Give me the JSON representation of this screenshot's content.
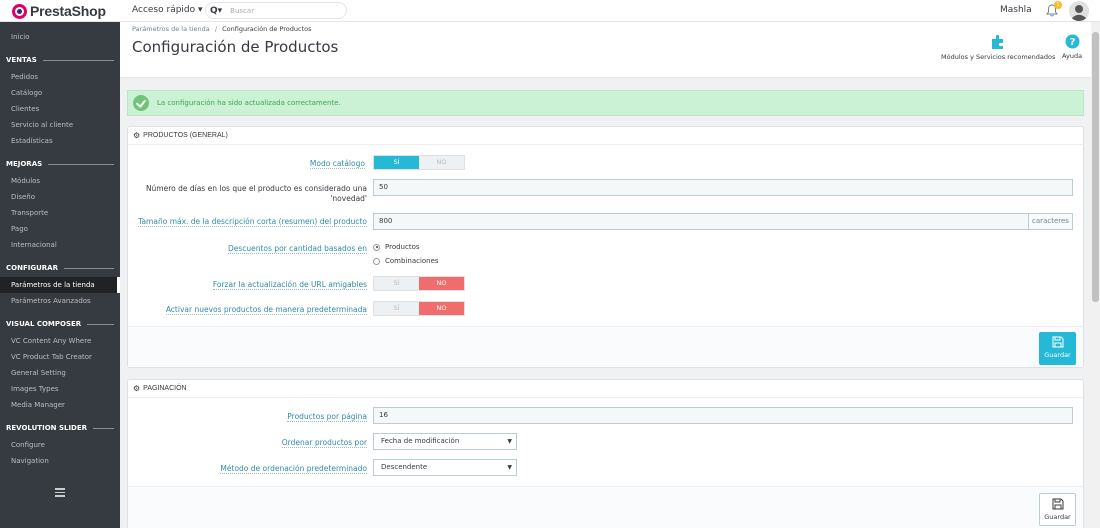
{
  "topbar": {
    "logo_text": "PrestaShop",
    "quick_access": "Acceso rápido ▾",
    "search_icon": "Q▾",
    "search_placeholder": "Buscar",
    "username": "Mashla",
    "notifications_count": "1"
  },
  "sidebar": {
    "items": [
      {
        "type": "item",
        "label": "Inicio"
      },
      {
        "type": "section",
        "label": "VENTAS"
      },
      {
        "type": "item",
        "label": "Pedidos"
      },
      {
        "type": "item",
        "label": "Catálogo"
      },
      {
        "type": "item",
        "label": "Clientes"
      },
      {
        "type": "item",
        "label": "Servicio al cliente"
      },
      {
        "type": "item",
        "label": "Estadísticas"
      },
      {
        "type": "section",
        "label": "MEJORAS"
      },
      {
        "type": "item",
        "label": "Módulos"
      },
      {
        "type": "item",
        "label": "Diseño"
      },
      {
        "type": "item",
        "label": "Transporte"
      },
      {
        "type": "item",
        "label": "Pago"
      },
      {
        "type": "item",
        "label": "Internacional"
      },
      {
        "type": "section",
        "label": "CONFIGURAR"
      },
      {
        "type": "item",
        "label": "Parámetros de la tienda",
        "active": true
      },
      {
        "type": "item",
        "label": "Parámetros Avanzados"
      },
      {
        "type": "section",
        "label": "VISUAL COMPOSER"
      },
      {
        "type": "item",
        "label": "VC Content Any Where"
      },
      {
        "type": "item",
        "label": "VC Product Tab Creator"
      },
      {
        "type": "item",
        "label": "General Setting"
      },
      {
        "type": "item",
        "label": "Images Types"
      },
      {
        "type": "item",
        "label": "Media Manager"
      },
      {
        "type": "section",
        "label": "REVOLUTION SLIDER"
      },
      {
        "type": "item",
        "label": "Configure"
      },
      {
        "type": "item",
        "label": "Navigation"
      }
    ]
  },
  "header": {
    "breadcrumb_parent": "Parámetros de la tienda",
    "breadcrumb_separator": "/",
    "breadcrumb_current": "Configuración de Productos",
    "title": "Configuración de Productos",
    "modules_label": "Módulos y Servicios recomendados",
    "help_label": "Ayuda"
  },
  "alert": {
    "message": "La configuración ha sido actualizada correctamente."
  },
  "general": {
    "title": "PRODUCTOS (GENERAL)",
    "catalog_mode_label": "Modo catálogo",
    "catalog_mode_yes": "SÍ",
    "catalog_mode_no": "NO",
    "new_days_label_1": "Número de días en los que el producto es considerado una",
    "new_days_label_2": "'novedad'",
    "new_days_value": "50",
    "short_desc_label": "Tamaño máx. de la descripción corta (resumen) del producto",
    "short_desc_value": "800",
    "short_desc_unit": "caracteres",
    "discounts_label": "Descuentos por cantidad basados en",
    "discounts_opt1": "Productos",
    "discounts_opt2": "Combinaciones",
    "force_url_label": "Forzar la actualización de URL amigables",
    "force_url_yes": "SÍ",
    "force_url_no": "NO",
    "activate_new_label": "Activar nuevos productos de manera predeterminada",
    "activate_new_yes": "SÍ",
    "activate_new_no": "NO",
    "save_label": "Guardar"
  },
  "pagination": {
    "title": "PAGINACIÓN",
    "per_page_label": "Productos por página",
    "per_page_value": "16",
    "order_by_label": "Ordenar productos por",
    "order_by_value": "Fecha de modificación",
    "order_method_label": "Método de ordenación predeterminado",
    "order_method_value": "Descendente",
    "save_label": "Guardar"
  },
  "colors": {
    "accent": "#25b9d7",
    "sidebar_bg": "#363a41",
    "success_bg": "#cbf2d4",
    "no_active": "#ef6d6d"
  }
}
